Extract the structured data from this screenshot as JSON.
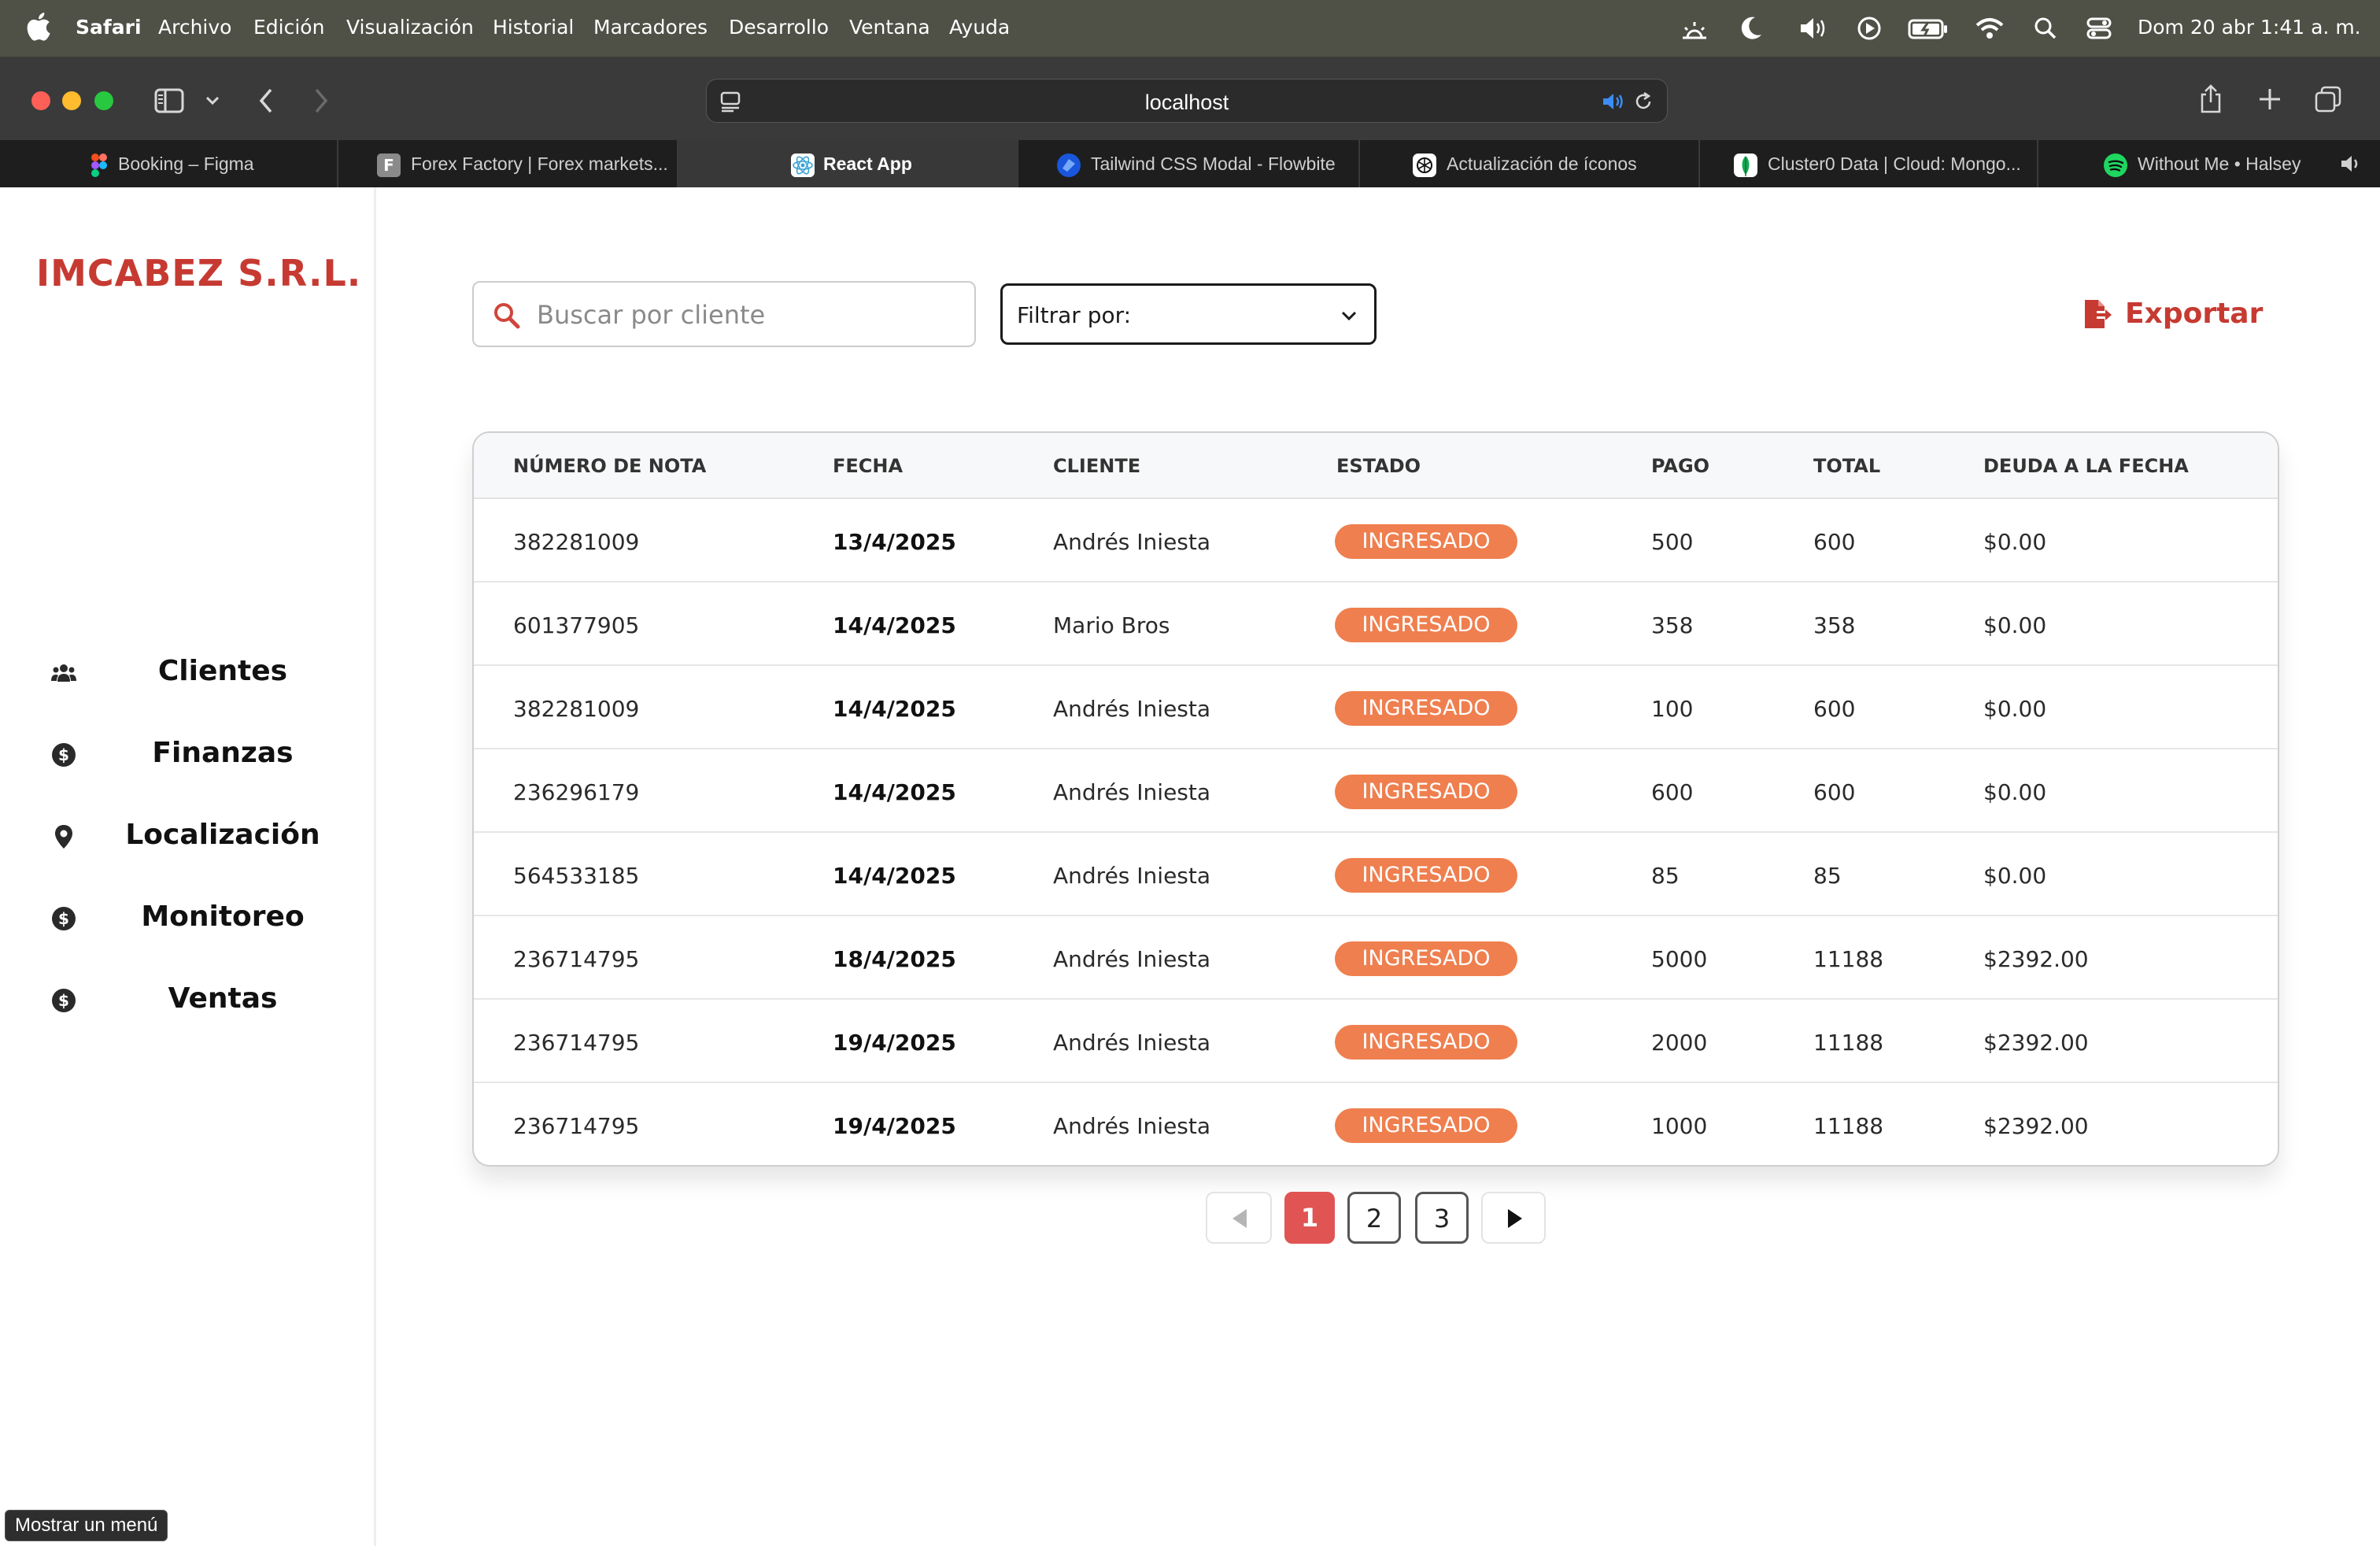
{
  "menubar": {
    "app": "Safari",
    "items": [
      "Archivo",
      "Edición",
      "Visualización",
      "Historial",
      "Marcadores",
      "Desarrollo",
      "Ventana",
      "Ayuda"
    ],
    "clock": "Dom 20 abr  1:41 a. m."
  },
  "browser": {
    "url": "localhost",
    "tabs": [
      {
        "label": "Booking – Figma",
        "icon": "figma-icon"
      },
      {
        "label": "Forex Factory | Forex markets...",
        "icon": "forex-factory-icon"
      },
      {
        "label": "React App",
        "icon": "react-icon",
        "active": true
      },
      {
        "label": "Tailwind CSS Modal - Flowbite",
        "icon": "flowbite-icon"
      },
      {
        "label": "Actualización de íconos",
        "icon": "openai-icon"
      },
      {
        "label": "Cluster0 Data | Cloud: Mongo...",
        "icon": "mongodb-icon"
      },
      {
        "label": "Without Me • Halsey",
        "icon": "spotify-icon"
      }
    ]
  },
  "sidebar": {
    "brand": "IMCABEZ S.R.L.",
    "items": [
      {
        "label": "Clientes",
        "icon": "users-icon"
      },
      {
        "label": "Finanzas",
        "icon": "dollar-circle-icon"
      },
      {
        "label": "Localización",
        "icon": "map-pin-icon"
      },
      {
        "label": "Monitoreo",
        "icon": "dollar-circle-icon"
      },
      {
        "label": "Ventas",
        "icon": "dollar-circle-icon"
      }
    ]
  },
  "search": {
    "placeholder": "Buscar por cliente",
    "value": ""
  },
  "filter": {
    "selected": "Filtrar por:"
  },
  "export": {
    "label": "Exportar"
  },
  "table": {
    "headers": [
      "NÚMERO DE NOTA",
      "FECHA",
      "CLIENTE",
      "ESTADO",
      "PAGO",
      "TOTAL",
      "DEUDA A LA FECHA"
    ],
    "rows": [
      [
        "382281009",
        "13/4/2025",
        "Andrés Iniesta",
        "INGRESADO",
        "500",
        "600",
        "$0.00"
      ],
      [
        "601377905",
        "14/4/2025",
        "Mario Bros",
        "INGRESADO",
        "358",
        "358",
        "$0.00"
      ],
      [
        "382281009",
        "14/4/2025",
        "Andrés Iniesta",
        "INGRESADO",
        "100",
        "600",
        "$0.00"
      ],
      [
        "236296179",
        "14/4/2025",
        "Andrés Iniesta",
        "INGRESADO",
        "600",
        "600",
        "$0.00"
      ],
      [
        "564533185",
        "14/4/2025",
        "Andrés Iniesta",
        "INGRESADO",
        "85",
        "85",
        "$0.00"
      ],
      [
        "236714795",
        "18/4/2025",
        "Andrés Iniesta",
        "INGRESADO",
        "5000",
        "11188",
        "$2392.00"
      ],
      [
        "236714795",
        "19/4/2025",
        "Andrés Iniesta",
        "INGRESADO",
        "2000",
        "11188",
        "$2392.00"
      ],
      [
        "236714795",
        "19/4/2025",
        "Andrés Iniesta",
        "INGRESADO",
        "1000",
        "11188",
        "$2392.00"
      ]
    ]
  },
  "pagination": {
    "pages": [
      "1",
      "2",
      "3"
    ],
    "current": "1"
  },
  "tooltip": "Mostrar un menú",
  "colors": {
    "brand": "#c63a32",
    "badge": "#ef7f4f",
    "active_page": "#e05453"
  }
}
